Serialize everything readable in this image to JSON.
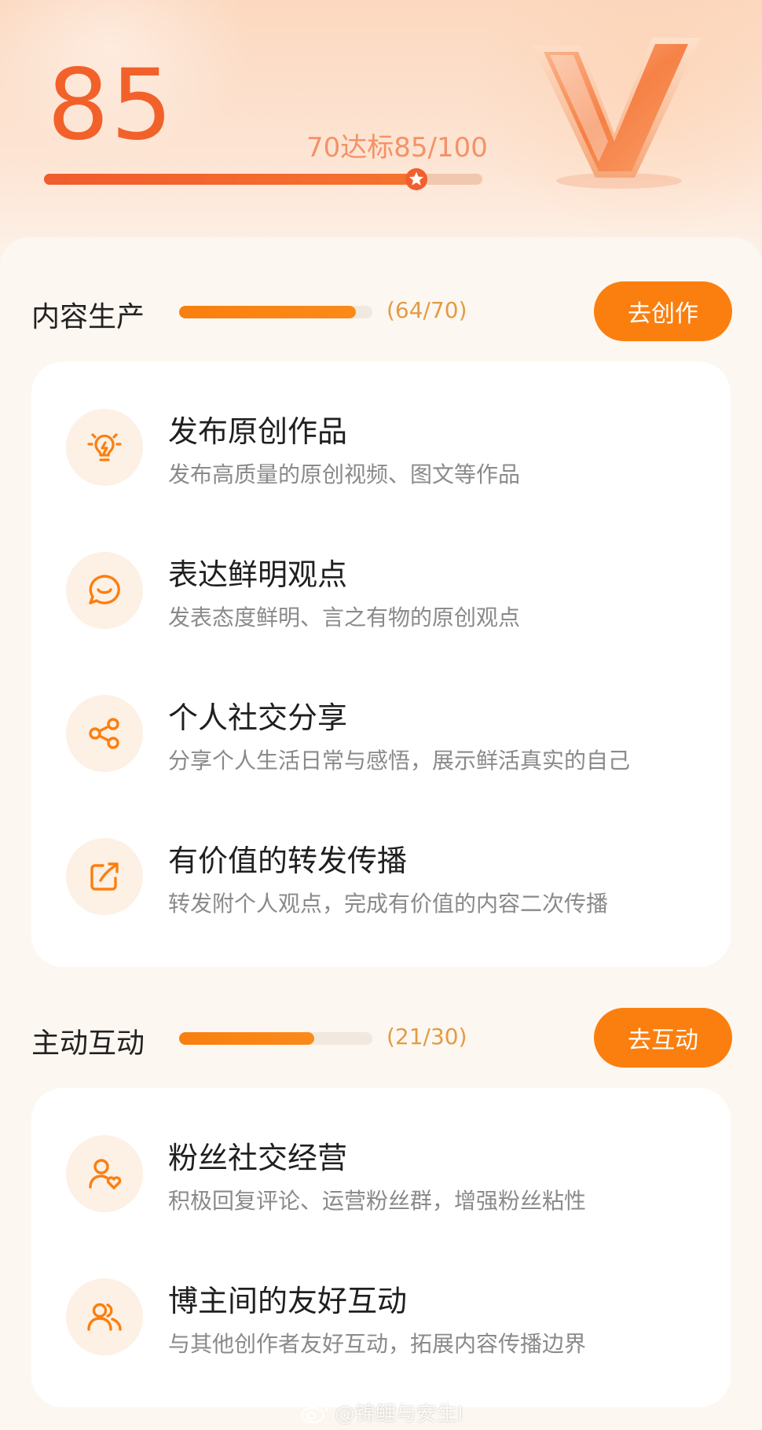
{
  "header": {
    "score": "85",
    "target_text": "70达标85/100",
    "score_progress": 0.85
  },
  "sections": [
    {
      "title": "内容生产",
      "progress": 0.914,
      "count": "(64/70)",
      "button_label": "去创作",
      "items": [
        {
          "title": "发布原创作品",
          "desc": "发布高质量的原创视频、图文等作品",
          "icon": "lightbulb-icon"
        },
        {
          "title": "表达鲜明观点",
          "desc": "发表态度鲜明、言之有物的原创观点",
          "icon": "chat-bubble-icon"
        },
        {
          "title": "个人社交分享",
          "desc": "分享个人生活日常与感悟，展示鲜活真实的自己",
          "icon": "share-icon"
        },
        {
          "title": "有价值的转发传播",
          "desc": "转发附个人观点，完成有价值的内容二次传播",
          "icon": "forward-icon"
        }
      ]
    },
    {
      "title": "主动互动",
      "progress": 0.7,
      "count": "(21/30)",
      "button_label": "去互动",
      "items": [
        {
          "title": "粉丝社交经营",
          "desc": "积极回复评论、运营粉丝群，增强粉丝粘性",
          "icon": "user-heart-icon"
        },
        {
          "title": "博主间的友好互动",
          "desc": "与其他创作者友好互动，拓展内容传播边界",
          "icon": "users-icon"
        }
      ]
    }
  ],
  "watermark": "@锦鲤与安生I",
  "colors": {
    "accent": "#fb7f0f",
    "score": "#f2612a",
    "count": "#e39b45"
  }
}
